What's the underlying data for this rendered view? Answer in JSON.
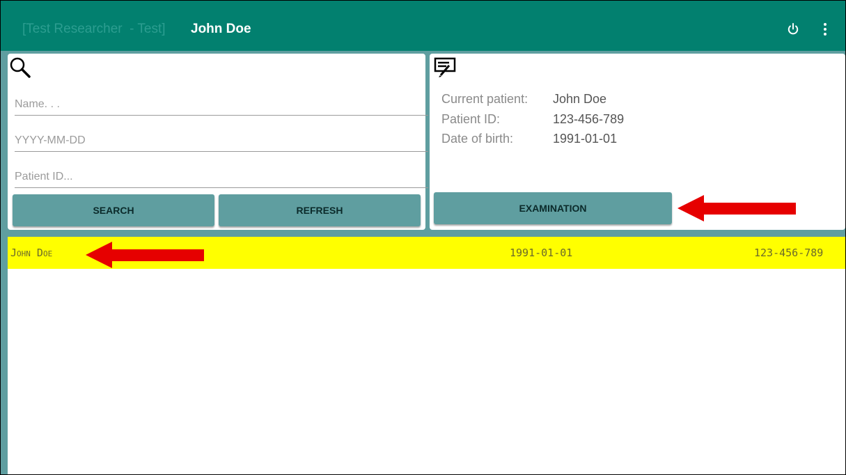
{
  "header": {
    "researcher_prefix": "[Test Researcher  - Test]",
    "patient_name": "John Doe",
    "power_icon": "power-icon",
    "menu_icon": "more-vert-icon"
  },
  "search": {
    "icon": "search-icon",
    "name_placeholder": "Name. . .",
    "date_placeholder": "YYYY-MM-DD",
    "id_placeholder": "Patient ID...",
    "search_label": "SEARCH",
    "refresh_label": "REFRESH"
  },
  "current_patient": {
    "icon": "edit-document-icon",
    "current_label": "Current patient:",
    "current_value": "John Doe",
    "id_label": "Patient ID:",
    "id_value": "123-456-789",
    "dob_label": "Date of birth:",
    "dob_value": "1991-01-01",
    "examination_label": "EXAMINATION"
  },
  "patients": [
    {
      "name": "John Doe",
      "dob": "1991-01-01",
      "id": "123-456-789"
    }
  ],
  "colors": {
    "appbar": "#02806f",
    "accent": "#5f9ea0",
    "selected_row": "#ffff00",
    "annotation_arrow": "#e00000"
  }
}
